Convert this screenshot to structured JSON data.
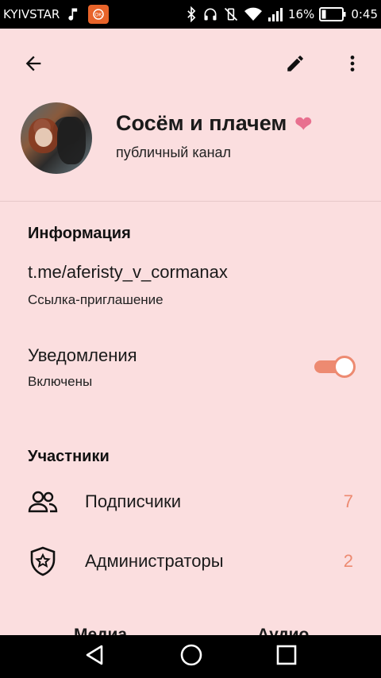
{
  "status_bar": {
    "carrier": "KYIVSTAR",
    "battery_percent": "16%",
    "time": "0:45",
    "app_badge_text": "ОК",
    "icons": [
      "music-icon",
      "bluetooth-icon",
      "headphones-icon",
      "vibrate-off-icon",
      "wifi-icon",
      "signal-icon",
      "battery-icon"
    ]
  },
  "header": {
    "channel_name": "Сосём и плачем",
    "heart": "❤",
    "channel_type": "публичный канал"
  },
  "info": {
    "title": "Информация",
    "link": "t.me/aferisty_v_cormanax",
    "link_caption": "Ссылка-приглашение"
  },
  "notifications": {
    "title": "Уведомления",
    "state": "Включены",
    "enabled": true
  },
  "members": {
    "title": "Участники",
    "rows": [
      {
        "label": "Подписчики",
        "count": "7",
        "icon": "people-icon"
      },
      {
        "label": "Администраторы",
        "count": "2",
        "icon": "admin-shield-icon"
      }
    ]
  },
  "media_tabs": {
    "media": "Медиа",
    "audio": "Аудио"
  },
  "colors": {
    "background": "#fbdedf",
    "accent": "#ed8a71",
    "heart": "#e8708f"
  }
}
